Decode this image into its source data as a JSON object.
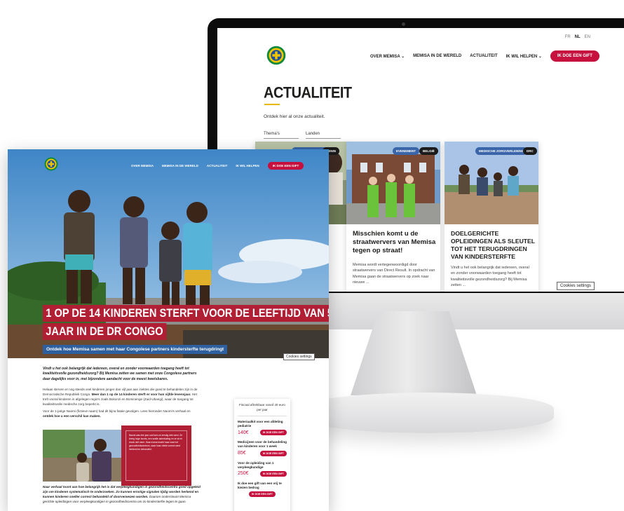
{
  "monitor_site": {
    "languages": [
      "FR",
      "NL",
      "EN"
    ],
    "active_language": "NL",
    "nav": [
      "OVER MEMISA",
      "MEMISA IN DE WERELD",
      "ACTUALITEIT",
      "IK WIL HELPEN"
    ],
    "gift_button": "IK DOE EEN GIFT",
    "page_title": "ACTUALITEIT",
    "page_subtitle": "Ontdek hier al onze actualiteit.",
    "filters": [
      "Thema's",
      "Landen"
    ],
    "cards": [
      {
        "tags": [
          "MEDISCHE ZORGEN",
          "BENIN"
        ],
        "title": "",
        "excerpt": ""
      },
      {
        "tags": [
          "EVENEMENT",
          "BELGIË"
        ],
        "title": "Misschien komt u de straatwervers van Memisa tegen op straat!",
        "excerpt": "Memisa wordt vertegenwoordigd door straatwervers van Direct Result. In opdracht van Memisa gaan de straatwervers op zoek naar nieuwe ..."
      },
      {
        "tags": [
          "MEDISCHE ZORGVERLENING",
          "DRC"
        ],
        "title": "DOELGERICHTE OPLEIDINGEN ALS SLEUTEL TOT HET TERUGDRINGEN VAN KINDERSTERFTE",
        "excerpt": "Vindt u het ook belangrijk dat iedereen, overal en zonder voorwaarden toegang heeft tot kwaliteitsvolle gezondheidszorg? Bij Memisa zetten ..."
      }
    ],
    "cookies_label": "Cookies settings"
  },
  "page": {
    "nav": [
      "OVER MEMISA",
      "MEMISA IN DE WERELD",
      "ACTUALITEIT",
      "IK WIL HELPEN"
    ],
    "gift_button": "IK DOE EEN GIFT",
    "headline_line1": "1 OP DE 14 KINDEREN STERFT VOOR DE LEEFTIJD VAN 5",
    "headline_line2": "JAAR IN DE DR CONGO",
    "headline_sub": "Ontdek hoe Memisa samen met haar Congolese partners kindersterfte terugdringt",
    "cookies_label": "Cookies settings",
    "intro": "Vindt u het ook belangrijk dat iedereen, overal en zonder voorwaarden toegang heeft tot kwaliteitsvolle gezondheidszorg? Bij Memisa zetten we samen met onze Congolese partners daar dagelijks voor in, met bijzondere aandacht voor de meest kwetsbaren.",
    "para1_a": "Helaas sterven er nog steeds veel kinderen jonger dan vijf jaar aan ziektes die goed te behandelen zijn in de Democratische Republiek Congo. ",
    "para1_b": "Meer dan 1 op de 14 kinderen sterft er voor hun vijfde levensjaar.",
    "para1_c": " Het treft vooral kinderen in afgelegen regio's zoals Bokonzi en Bominenge (Zuid-Ubangi), waar de toegang tot kwaliteitsvolle medische zorg beperkt is.",
    "para2_a": "Voor de 1-jarige Naomi (fictieve naam) had dit bijna fatale gevolgen. Lees hieronder Naomi's verhaal en ",
    "para2_b": "ontdek hoe u een verschil kan maken.",
    "quote": "Naomi was één jaar oud toen ze ernstig ziek werd. Ze kreeg hoge koorts, een snelle ademhaling en ze at en dronk niet meer. Haar mama bracht haar naar het gezondheidscentrum, waar haar ziekte correct werd herkend en behandeld.",
    "caption_a": "Naar verhaal toont aan hoe belangrijk het is dat verpleegkundigen in gezondheidscentra goed opgeleid zijn om kinderen systematisch te onderzoeken. Zo kunnen ernstige signalen tijdig worden herkend en kunnen kinderen sneller correct behandeld of doorverwezen worden.",
    "caption_b": " Daarom ondersteunt Memisa gerichte opleidingen voor verpleegkundigen in gezondheidscentra om zo kindersterfte tegen te gaan.",
    "donate_header": "Fiscaal aftrekbaar vanaf 40 euro per jaar",
    "donate_items": [
      {
        "label": "Materiaalkit voor een afdeling pediatrie",
        "price": "140€",
        "button": "IK DOE EEN GIFT"
      },
      {
        "label": "Medicijnen voor de behandeling van kinderen voor 1 week",
        "price": "85€",
        "button": "IK DOE EEN GIFT"
      },
      {
        "label": "Voor de opleiding van 1 verpleegkundige",
        "price": "250€",
        "button": "IK DOE EEN GIFT"
      },
      {
        "label": "Ik doe een gift van een vrij te kiezen bedrag",
        "price": "",
        "button": "IK DOE EEN GIFT"
      }
    ]
  },
  "colors": {
    "brand_red": "#c6103d",
    "headline_red": "#b11f35",
    "headline_blue": "#2e5f9e",
    "logo_green": "#0f8a3c",
    "logo_yellow": "#f2c300",
    "logo_blue": "#1a4f9c"
  },
  "icons": [
    "memisa-logo-icon",
    "chevron-down-icon"
  ]
}
